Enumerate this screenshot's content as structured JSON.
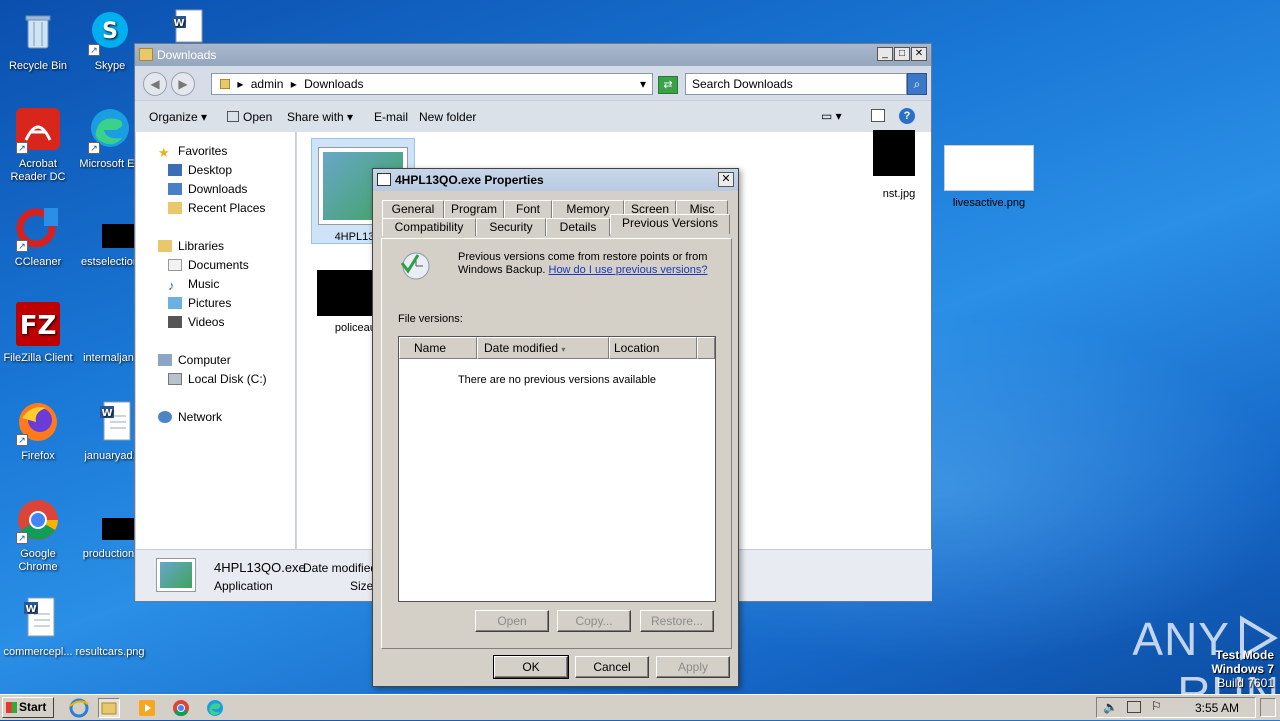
{
  "desktop": {
    "icons": [
      {
        "label": "Recycle Bin"
      },
      {
        "label": "Skype"
      },
      {
        "label": "Acrobat Reader DC"
      },
      {
        "label": "Microsoft Ed"
      },
      {
        "label": "CCleaner"
      },
      {
        "label": "estselection"
      },
      {
        "label": "FileZilla Client"
      },
      {
        "label": "internaljan."
      },
      {
        "label": "Firefox"
      },
      {
        "label": "januaryad."
      },
      {
        "label": "Google Chrome"
      },
      {
        "label": "production."
      },
      {
        "label": "commercepl..."
      },
      {
        "label": "resultcars.png"
      }
    ],
    "watermark": {
      "brand": "ANY",
      "brand2": "RUN",
      "mode": "Test Mode",
      "os": "Windows 7",
      "build": "Build 7601"
    }
  },
  "explorer": {
    "title": "Downloads",
    "address": [
      "admin",
      "Downloads"
    ],
    "search_placeholder": "Search Downloads",
    "toolbar": {
      "organize": "Organize",
      "open": "Open",
      "share_with": "Share with",
      "email": "E-mail",
      "new_folder": "New folder"
    },
    "nav": {
      "favorites": "Favorites",
      "desktop": "Desktop",
      "downloads": "Downloads",
      "recent": "Recent Places",
      "libraries": "Libraries",
      "documents": "Documents",
      "music": "Music",
      "pictures": "Pictures",
      "videos": "Videos",
      "computer": "Computer",
      "local_disk": "Local Disk (C:)",
      "network": "Network"
    },
    "files": [
      {
        "name": "4HPL13QO"
      },
      {
        "name": "nst.jpg"
      },
      {
        "name": "livesactive.png"
      },
      {
        "name": "policeauth"
      }
    ],
    "details": {
      "name": "4HPL13QO.exe",
      "type": "Application",
      "date_label": "Date modified:",
      "size_label": "Size:"
    }
  },
  "dialog": {
    "title": "4HPL13QO.exe Properties",
    "tabs_row1": [
      "General",
      "Program",
      "Font",
      "Memory",
      "Screen",
      "Misc"
    ],
    "tabs_row2": [
      "Compatibility",
      "Security",
      "Details",
      "Previous Versions"
    ],
    "active_tab": "Previous Versions",
    "info_line1": "Previous versions come from restore points or from",
    "info_line2_prefix": "Windows Backup.",
    "info_link": "How do I use previous versions?",
    "file_versions_label": "File versions:",
    "columns": [
      "Name",
      "Date modified",
      "Location"
    ],
    "empty_text": "There are no previous versions available",
    "panel_buttons": {
      "open": "Open",
      "copy": "Copy...",
      "restore": "Restore..."
    },
    "buttons": {
      "ok": "OK",
      "cancel": "Cancel",
      "apply": "Apply"
    }
  },
  "taskbar": {
    "start": "Start",
    "clock": "3:55 AM"
  }
}
